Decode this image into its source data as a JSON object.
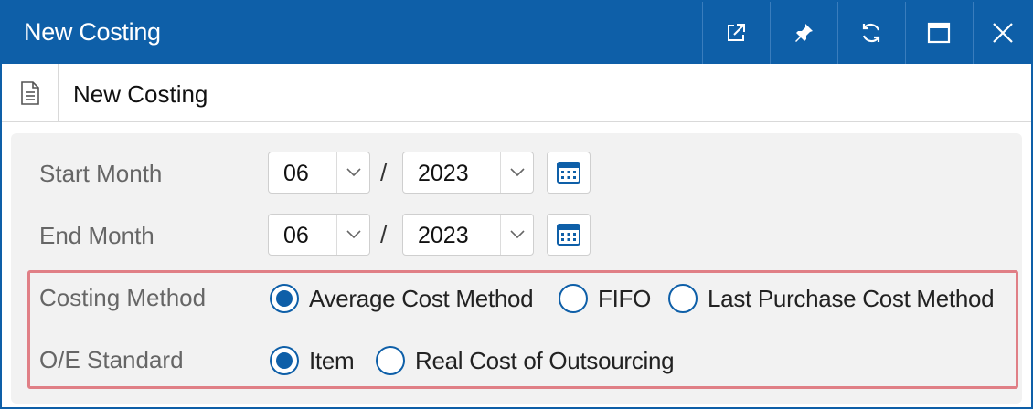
{
  "window": {
    "title": "New Costing",
    "buttons": [
      {
        "name": "popout-button",
        "icon": "external-link-icon"
      },
      {
        "name": "pin-button",
        "icon": "pin-icon"
      },
      {
        "name": "refresh-button",
        "icon": "refresh-icon"
      },
      {
        "name": "maximize-button",
        "icon": "maximize-icon"
      },
      {
        "name": "close-button",
        "icon": "close-icon"
      }
    ]
  },
  "docbar": {
    "icon": "document-icon",
    "title": "New Costing"
  },
  "form": {
    "start_month": {
      "label": "Start Month",
      "month": "06",
      "separator": "/",
      "year": "2023"
    },
    "end_month": {
      "label": "End Month",
      "month": "06",
      "separator": "/",
      "year": "2023"
    },
    "costing_method": {
      "label": "Costing Method",
      "options": [
        "Average Cost Method",
        "FIFO",
        "Last Purchase Cost Method"
      ],
      "selected": "Average Cost Method"
    },
    "oe_standard": {
      "label": "O/E Standard",
      "options": [
        "Item",
        "Real Cost of Outsourcing"
      ],
      "selected": "Item"
    }
  },
  "colors": {
    "accent": "#0e5fa8",
    "highlight_border": "#e07f86",
    "panel_bg": "#f2f2f2"
  }
}
